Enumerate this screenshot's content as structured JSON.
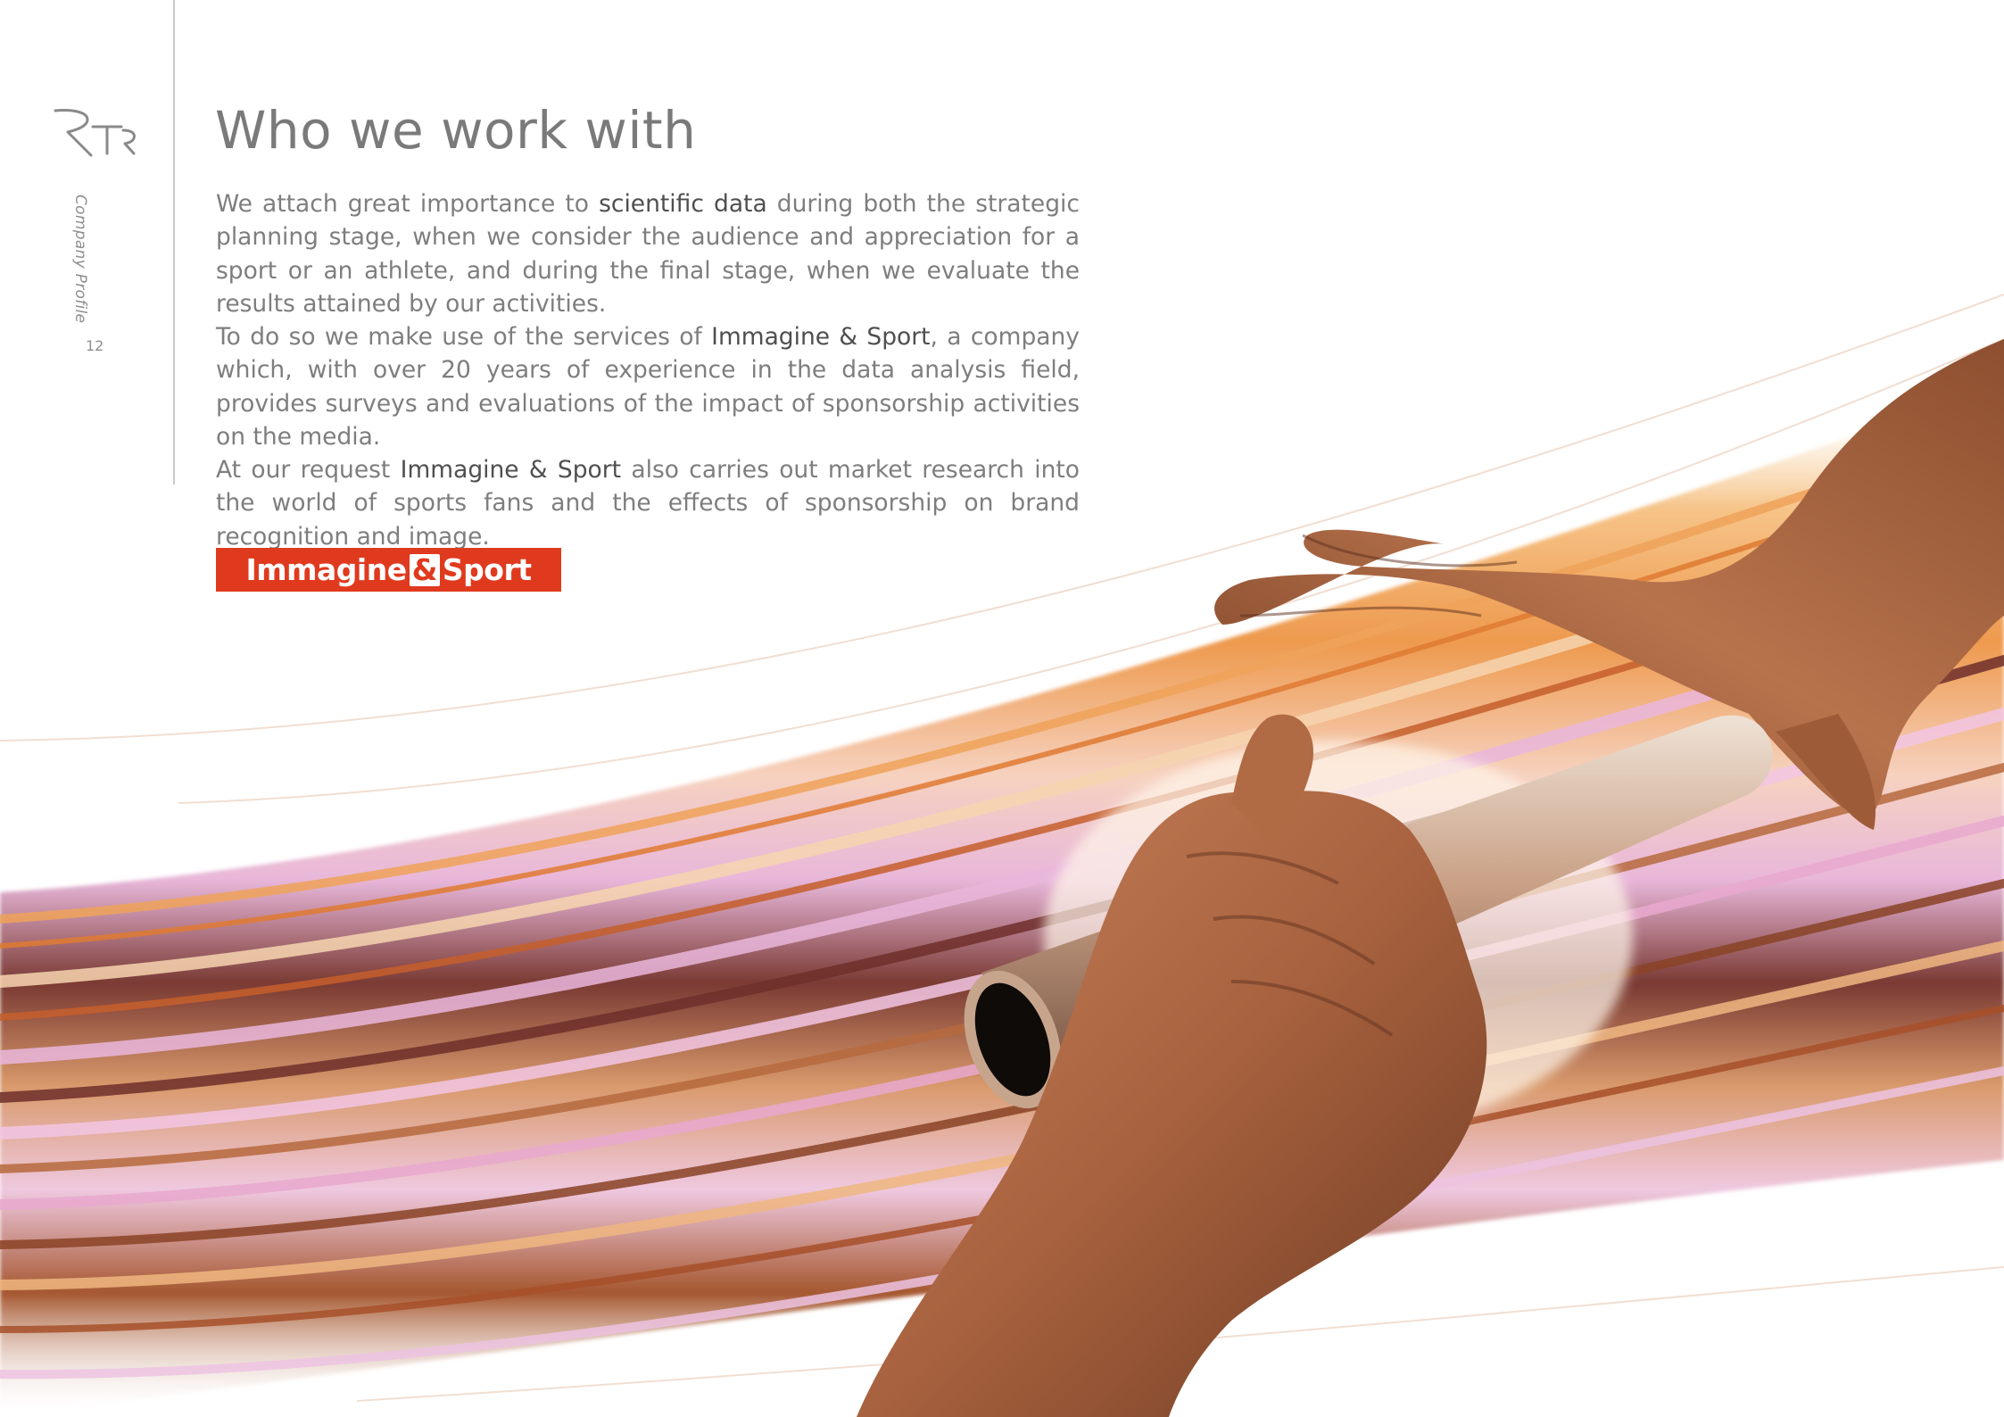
{
  "header": {
    "logo_text": "RTR",
    "section_label": "Company Profile",
    "page_number": "12"
  },
  "main": {
    "title": "Who we work with",
    "p1": {
      "a": "We attach great importance to ",
      "b": "scientific data",
      "c": " during both the strategic planning stage, when we consider the audience and appreciation for a sport or an athlete, and during the final stage, when we evaluate the results attained by our activities."
    },
    "p2": {
      "a": "To do so we make use of the services of ",
      "b": "Immagine & Sport",
      "c": ", a company which, with over 20 years of experience in the data analysis field, provides surveys and evaluations of the impact of sponsorship activities on the media."
    },
    "p3": {
      "a": "At our request ",
      "b": "Immagine & Sport",
      "c": " also carries out market research into the world of sports fans and the effects of sponsorship on brand recognition and image."
    }
  },
  "partner_logo": {
    "left": "Immagine",
    "amp": "&",
    "right": "Sport",
    "color": "#e03a1e"
  },
  "artwork": {
    "subject": "relay baton handover between two hands over light streaks",
    "colors": [
      "#f0a050",
      "#c8764a",
      "#7a3a2a",
      "#e4b4d8",
      "#ffffff"
    ]
  }
}
